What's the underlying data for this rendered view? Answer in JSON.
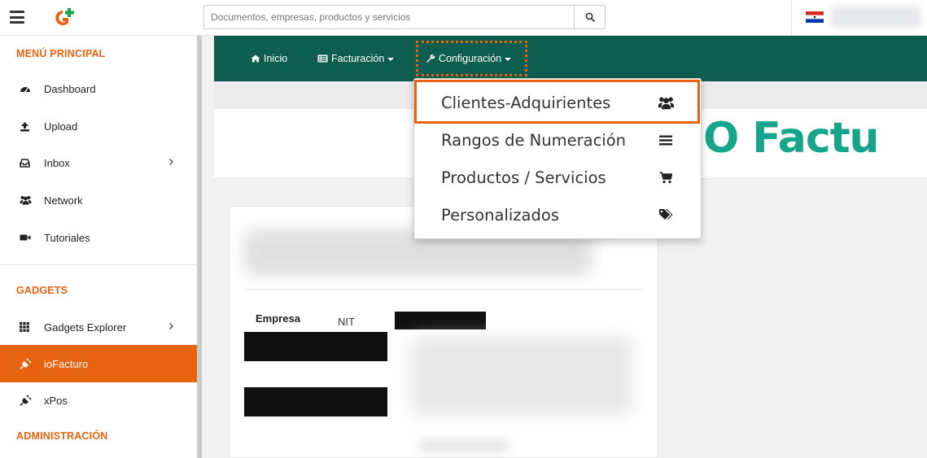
{
  "topbar": {
    "search_placeholder": "Documentos, empresas, productos y servicios"
  },
  "sidebar": {
    "main_heading": "MENÚ PRINCIPAL",
    "main_items": [
      {
        "label": "Dashboard",
        "icon": "dashboard-icon"
      },
      {
        "label": "Upload",
        "icon": "upload-icon"
      },
      {
        "label": "Inbox",
        "icon": "inbox-icon",
        "has_submenu": true
      },
      {
        "label": "Network",
        "icon": "users-icon"
      },
      {
        "label": "Tutoriales",
        "icon": "video-camera-icon"
      }
    ],
    "gadgets_heading": "GADGETS",
    "gadget_items": [
      {
        "label": "Gadgets Explorer",
        "icon": "grid-icon",
        "has_submenu": true
      },
      {
        "label": "ioFacturo",
        "icon": "plug-icon",
        "active": true
      },
      {
        "label": "xPos",
        "icon": "plug-icon"
      }
    ],
    "admin_heading": "ADMINISTRACIÓN"
  },
  "navbar": {
    "inicio": "Inicio",
    "facturacion": "Facturación",
    "configuracion": "Configuración"
  },
  "dropdown": {
    "items": [
      {
        "label": "Clientes-Adquirientes",
        "icon": "users-icon",
        "highlighted": true
      },
      {
        "label": "Rangos de Numeración",
        "icon": "bars-icon"
      },
      {
        "label": "Productos / Servicios",
        "icon": "shopping-cart-icon"
      },
      {
        "label": "Personalizados",
        "icon": "tags-icon"
      }
    ]
  },
  "banner": {
    "brand_text": "O Factu"
  },
  "card": {
    "empresa_label": "Empresa",
    "nit_label": "NIT"
  },
  "colors": {
    "accent": "#e8630f",
    "navbar": "#0e5e4f",
    "brand_teal": "#17a589"
  }
}
